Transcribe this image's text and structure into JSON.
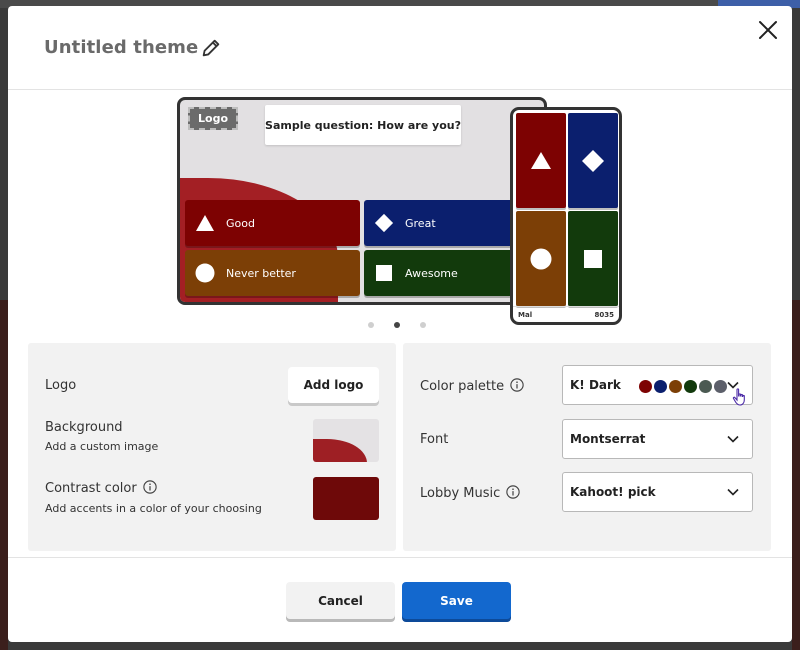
{
  "dialog": {
    "title": "Untitled theme"
  },
  "preview": {
    "logo_badge": "Logo",
    "question": "Sample question: How are you?",
    "answers": [
      {
        "label": "Good",
        "shape": "triangle",
        "color": "#7d0202"
      },
      {
        "label": "Great",
        "shape": "diamond",
        "color": "#0b1f6e"
      },
      {
        "label": "Never better",
        "shape": "circle",
        "color": "#7c3f06"
      },
      {
        "label": "Awesome",
        "shape": "square",
        "color": "#123a0c"
      }
    ],
    "phone_footer": {
      "name": "Mal",
      "score": "8035"
    },
    "carousel": {
      "pages": 3,
      "active": 2
    }
  },
  "left_panel": {
    "logo_label": "Logo",
    "add_logo_button": "Add logo",
    "background_label": "Background",
    "background_sub": "Add a custom image",
    "contrast_label": "Contrast color",
    "contrast_sub": "Add accents in a color of your choosing",
    "contrast_color": "#6e0909"
  },
  "right_panel": {
    "palette_label": "Color palette",
    "palette_value": "K! Dark",
    "palette_colors": [
      "#7d0202",
      "#0b1f6e",
      "#7c3f06",
      "#123a0c",
      "#4b5a52",
      "#5c5f6a"
    ],
    "font_label": "Font",
    "font_value": "Montserrat",
    "music_label": "Lobby Music",
    "music_value": "Kahoot! pick"
  },
  "footer": {
    "cancel_label": "Cancel",
    "save_label": "Save"
  }
}
